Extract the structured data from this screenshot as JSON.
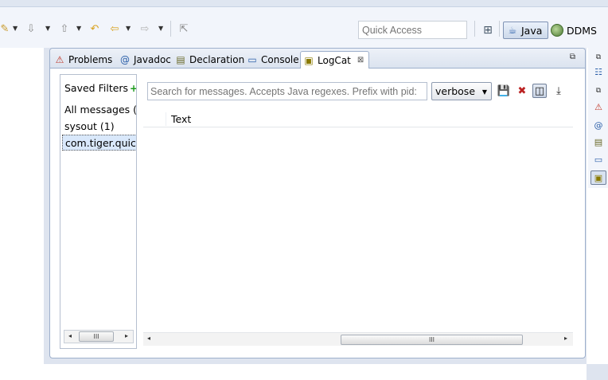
{
  "toolbar": {
    "quick_access": {
      "placeholder": "Quick Access"
    },
    "perspectives": [
      {
        "label": "Java",
        "active": true
      },
      {
        "label": "DDMS",
        "active": false
      }
    ]
  },
  "view": {
    "tabs": [
      {
        "label": "Problems",
        "icon": "problems-icon",
        "active": false
      },
      {
        "label": "Javadoc",
        "icon": "at-icon",
        "active": false
      },
      {
        "label": "Declaration",
        "icon": "declaration-icon",
        "active": false
      },
      {
        "label": "Console",
        "icon": "console-icon",
        "active": false
      },
      {
        "label": "LogCat",
        "icon": "logcat-icon",
        "active": true,
        "close_glyph": "⊠"
      }
    ]
  },
  "logcat": {
    "saved_filters": {
      "title": "Saved Filters",
      "add_glyph": "+",
      "items": [
        {
          "label": "All messages (",
          "selected": false
        },
        {
          "label": "sysout (1)",
          "selected": false
        },
        {
          "label": "com.tiger.quic",
          "selected": true
        }
      ]
    },
    "search": {
      "placeholder": "Search for messages. Accepts Java regexes. Prefix with pid:"
    },
    "level": {
      "selected": "verbose"
    },
    "columns": [
      "Text"
    ],
    "scroll_grip": "III"
  },
  "colors": {
    "accent": "#9eb0cc",
    "toolbar_bg": "#f2f5fb",
    "workarea_bg": "#dee4ef",
    "selection_bg": "#d9e8fb"
  }
}
